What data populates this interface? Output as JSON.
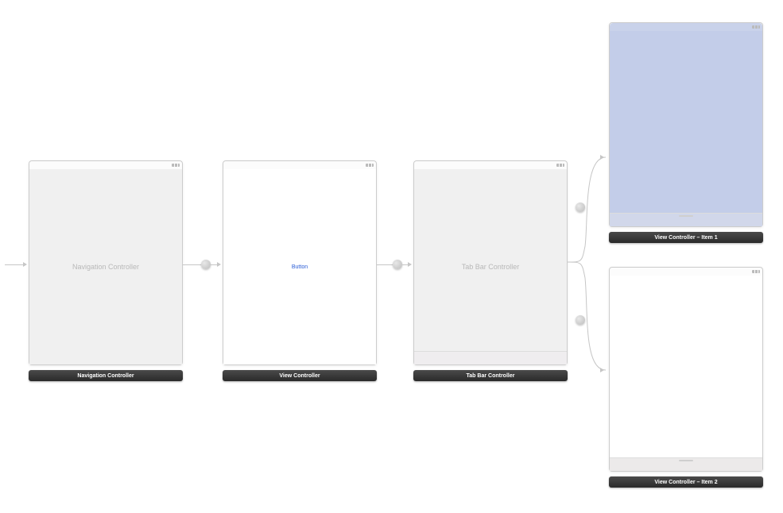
{
  "scenes": {
    "nav": {
      "title": "Navigation Controller",
      "body_label": "Navigation Controller"
    },
    "vc": {
      "title": "View Controller",
      "button": "Button"
    },
    "tab": {
      "title": "Tab Bar Controller",
      "body_label": "Tab Bar Controller"
    },
    "item1": {
      "title": "View Controller – Item 1"
    },
    "item2": {
      "title": "View Controller – Item 2"
    }
  }
}
